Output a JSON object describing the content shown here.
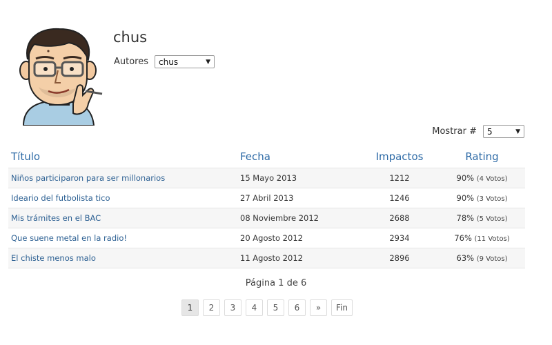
{
  "author": {
    "name": "chus"
  },
  "authors_filter": {
    "label": "Autores",
    "selected": "chus"
  },
  "per_page": {
    "label": "Mostrar #",
    "selected": "5"
  },
  "table": {
    "headers": {
      "title": "Título",
      "date": "Fecha",
      "impacts": "Impactos",
      "rating": "Rating"
    },
    "rows": [
      {
        "title": "Niños participaron para ser millonarios",
        "date": "15 Mayo 2013",
        "impacts": "1212",
        "rating": "90%",
        "votes": "(4 Votos)"
      },
      {
        "title": "Ideario del futbolista tico",
        "date": "27 Abril 2013",
        "impacts": "1246",
        "rating": "90%",
        "votes": "(3 Votos)"
      },
      {
        "title": "Mis trámites en el BAC",
        "date": "08 Noviembre 2012",
        "impacts": "2688",
        "rating": "78%",
        "votes": "(5 Votos)"
      },
      {
        "title": "Que suene metal en la radio!",
        "date": "20 Agosto 2012",
        "impacts": "2934",
        "rating": "76%",
        "votes": "(11 Votos)"
      },
      {
        "title": "El chiste menos malo",
        "date": "11 Agosto 2012",
        "impacts": "2896",
        "rating": "63%",
        "votes": "(9 Votos)"
      }
    ]
  },
  "pagination": {
    "info": "Página 1 de 6",
    "pages": [
      "1",
      "2",
      "3",
      "4",
      "5",
      "6"
    ],
    "next": "»",
    "last": "Fin",
    "current": 1
  }
}
